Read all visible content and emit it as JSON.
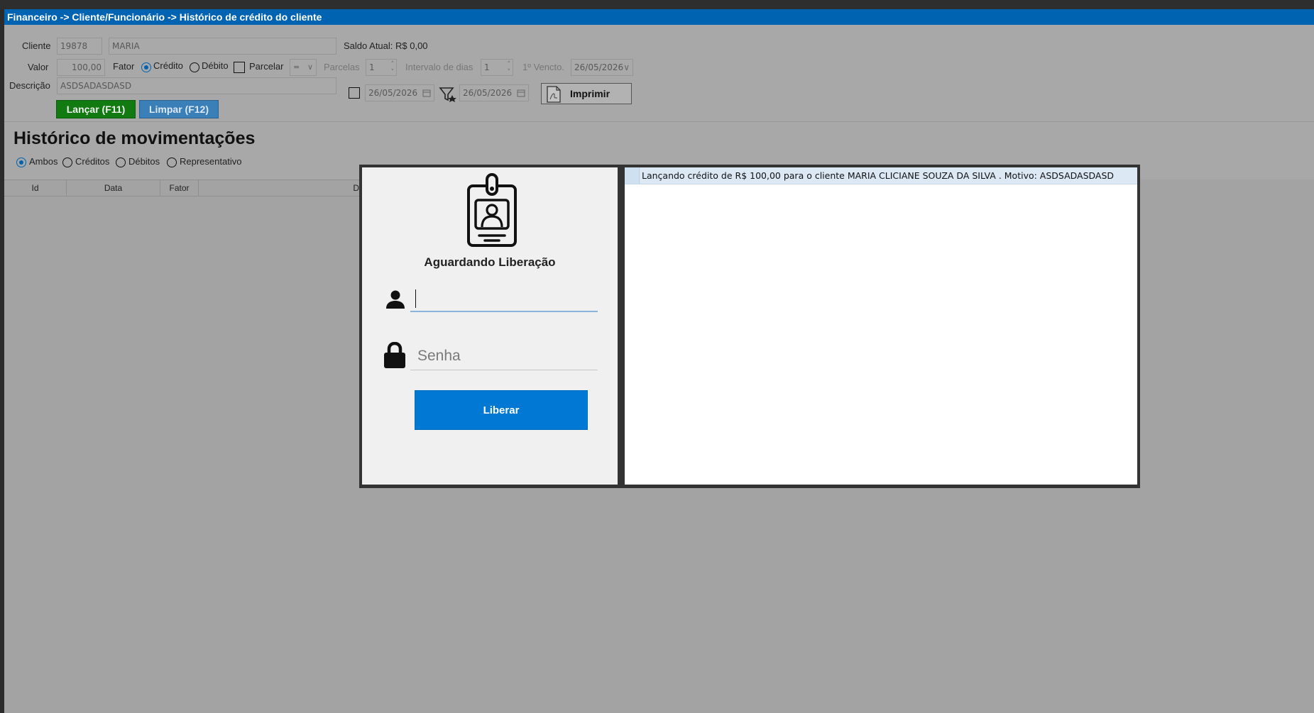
{
  "window": {
    "breadcrumb": "Financeiro -> Cliente/Funcionário -> Histórico de crédito do cliente"
  },
  "form": {
    "cliente_label": "Cliente",
    "cliente_id": "19878",
    "cliente_nome": "MARIA",
    "saldo_text": "Saldo Atual: R$ 0,00",
    "valor_label": "Valor",
    "valor": "100,00",
    "fator_label": "Fator",
    "credito_label": "Crédito",
    "credito_checked": true,
    "debito_label": "Débito",
    "parcelar_label": "Parcelar",
    "parcelas_select": "=",
    "parcelas_label": "Parcelas",
    "parcelas_value": "1",
    "intervalo_label": "Intervalo de dias",
    "intervalo_value": "1",
    "vencimento_label": "1º Vencto.",
    "vencimento_value": "26/05/2026",
    "descricao_label": "Descrição",
    "descricao_value": "ASDSADASDASD",
    "date_from": "26/05/2026",
    "date_to": "26/05/2026",
    "lancar_button": "Lançar (F11)",
    "limpar_button": "Limpar (F12)",
    "imprimir_button": "Imprimir"
  },
  "history": {
    "title": "Histórico de movimentações",
    "filters": [
      {
        "label": "Ambos",
        "checked": true
      },
      {
        "label": "Créditos",
        "checked": false
      },
      {
        "label": "Débitos",
        "checked": false
      },
      {
        "label": "Representativo",
        "checked": false
      }
    ],
    "columns": [
      "Id",
      "Data",
      "Fator",
      "D"
    ]
  },
  "modal": {
    "title": "Aguardando Liberação",
    "user_value": "",
    "password_placeholder": "Senha",
    "liberar_button": "Liberar",
    "log": [
      "Lançando crédito de R$ 100,00 para o cliente MARIA CLICIANE SOUZA DA SILVA . Motivo: ASDSADASDASD"
    ]
  },
  "colors": {
    "titlebar": "#0063b1",
    "lancar": "#117a10",
    "limpar": "#3b7fb8",
    "liberar": "#0078d4"
  },
  "icons": {
    "badge": "id-badge-icon",
    "user": "user-icon",
    "lock": "lock-icon",
    "calendar": "calendar-icon",
    "filter": "filter-icon",
    "pdf": "pdf-icon"
  }
}
